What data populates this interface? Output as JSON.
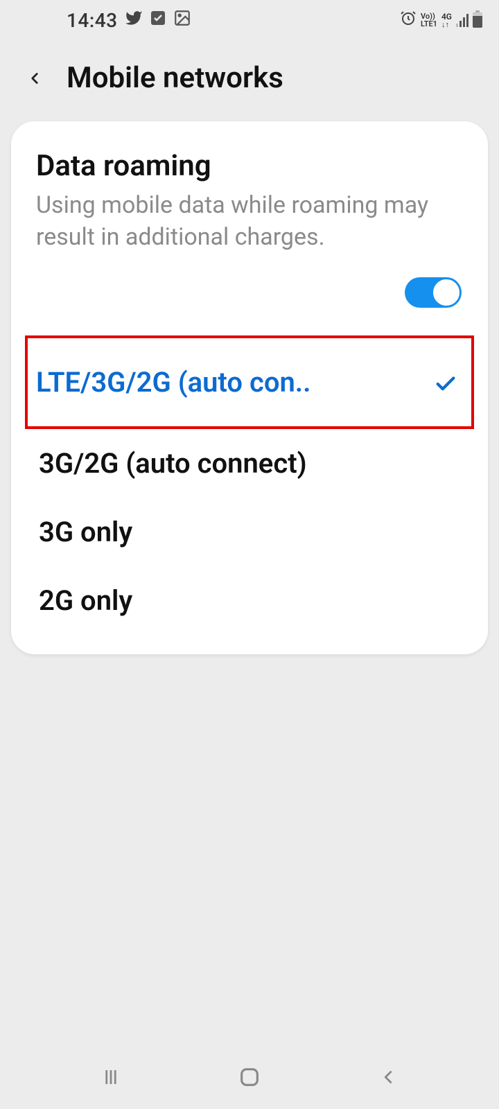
{
  "status_bar": {
    "time": "14:43",
    "icons": [
      "twitter",
      "checkbox",
      "image"
    ],
    "right": {
      "alarm": true,
      "net_top": "Vo))",
      "net_bottom": "LTE1",
      "gen": "4G",
      "arrows": "↓↑"
    }
  },
  "header": {
    "title": "Mobile networks"
  },
  "roaming": {
    "title": "Data roaming",
    "desc": "Using mobile data while roaming may result in additional charges.",
    "enabled": true
  },
  "network_modes": {
    "selected_index": 0,
    "options": [
      {
        "label": "LTE/3G/2G (auto con.."
      },
      {
        "label": "3G/2G (auto connect)"
      },
      {
        "label": "3G only"
      },
      {
        "label": "2G only"
      }
    ]
  },
  "accent_color": "#0c6bd0",
  "highlight_border": "#e60000"
}
